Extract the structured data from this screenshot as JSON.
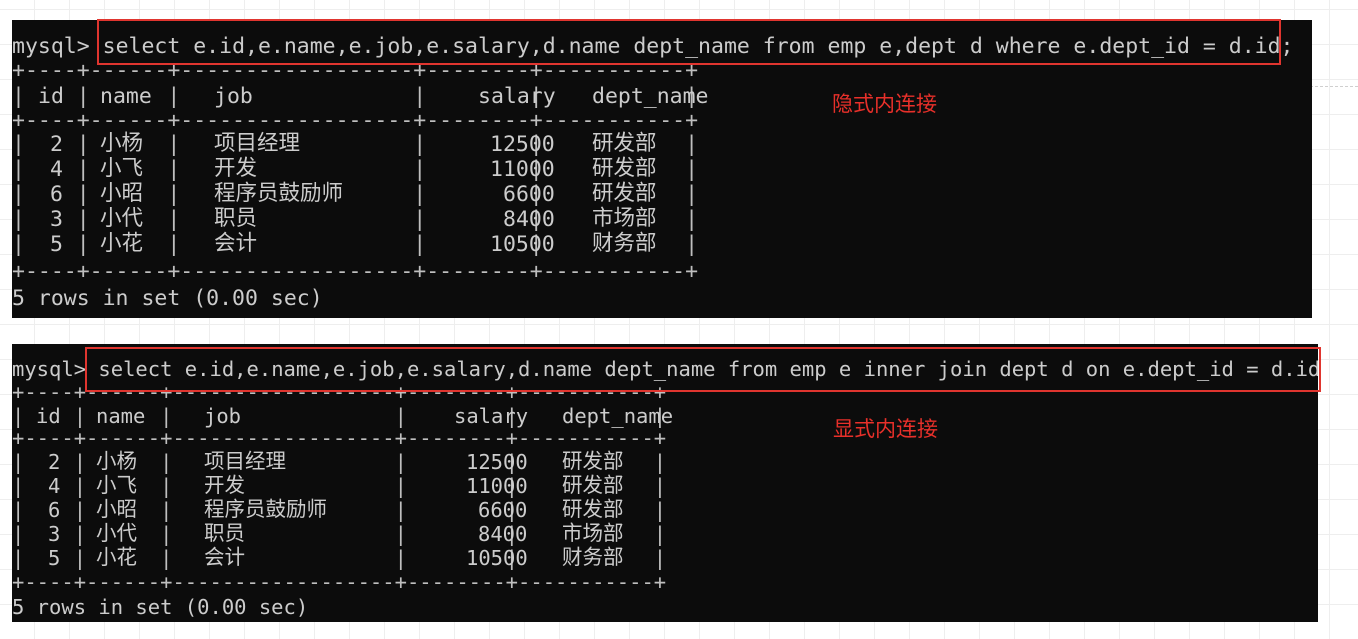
{
  "queries": [
    {
      "prompt": "mysql>",
      "sql": "select e.id,e.name,e.job,e.salary,d.name dept_name from emp e,dept d where e.dept_id = d.id;",
      "annotation": "隐式内连接",
      "table": {
        "border_top": "+----+------+------------------+--------+-----------+",
        "columns": [
          "id",
          "name",
          "job",
          "salary",
          "dept_name"
        ],
        "rows": [
          [
            "2",
            "小杨",
            "项目经理",
            "12500",
            "研发部"
          ],
          [
            "4",
            "小飞",
            "开发",
            "11000",
            "研发部"
          ],
          [
            "6",
            "小昭",
            "程序员鼓励师",
            "6600",
            "研发部"
          ],
          [
            "3",
            "小代",
            "职员",
            "8400",
            "市场部"
          ],
          [
            "5",
            "小花",
            "会计",
            "10500",
            "财务部"
          ]
        ]
      },
      "footer": "5 rows in set (0.00 sec)"
    },
    {
      "prompt": "mysql>",
      "sql": "select e.id,e.name,e.job,e.salary,d.name dept_name from emp e inner join dept d on e.dept_id = d.id;",
      "annotation": "显式内连接",
      "table": {
        "border_top": "+----+------+------------------+--------+-----------+",
        "columns": [
          "id",
          "name",
          "job",
          "salary",
          "dept_name"
        ],
        "rows": [
          [
            "2",
            "小杨",
            "项目经理",
            "12500",
            "研发部"
          ],
          [
            "4",
            "小飞",
            "开发",
            "11000",
            "研发部"
          ],
          [
            "6",
            "小昭",
            "程序员鼓励师",
            "6600",
            "研发部"
          ],
          [
            "3",
            "小代",
            "职员",
            "8400",
            "市场部"
          ],
          [
            "5",
            "小花",
            "会计",
            "10500",
            "财务部"
          ]
        ]
      },
      "footer": "5 rows in set (0.00 sec)"
    }
  ],
  "colors": {
    "terminal_bg": "#0c0c0c",
    "terminal_text": "#cccccc",
    "highlight": "#e0352f",
    "annotation": "#e8302a"
  }
}
